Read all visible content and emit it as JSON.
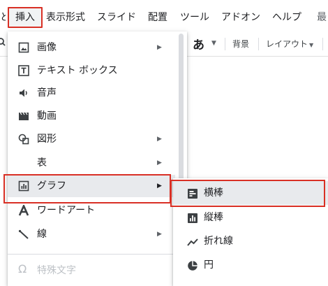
{
  "menubar": {
    "cut_left": "と",
    "items": [
      "挿入",
      "表示形式",
      "スライド",
      "配置",
      "ツール",
      "アドオン",
      "ヘルプ"
    ],
    "cut_right": "最"
  },
  "toolbar": {
    "font_glyph": "あ",
    "background_label": "背景",
    "layout_label": "レイアウト"
  },
  "insert_menu": {
    "items": [
      {
        "label": "画像",
        "icon": "image-icon",
        "has_submenu": true
      },
      {
        "label": "テキスト ボックス",
        "icon": "text-box-icon",
        "has_submenu": false
      },
      {
        "label": "音声",
        "icon": "audio-icon",
        "has_submenu": false
      },
      {
        "label": "動画",
        "icon": "video-icon",
        "has_submenu": false
      },
      {
        "label": "図形",
        "icon": "shape-icon",
        "has_submenu": true
      },
      {
        "label": "表",
        "icon": "",
        "has_submenu": true
      },
      {
        "label": "グラフ",
        "icon": "chart-icon",
        "has_submenu": true,
        "highlighted": true
      },
      {
        "label": "ワードアート",
        "icon": "word-art-icon",
        "has_submenu": false
      },
      {
        "label": "線",
        "icon": "line-icon",
        "has_submenu": true
      },
      {
        "label": "特殊文字",
        "icon": "omega-icon",
        "has_submenu": false,
        "disabled": true
      }
    ]
  },
  "chart_submenu": {
    "items": [
      {
        "label": "横棒",
        "icon": "bar-chart-icon",
        "highlighted": true
      },
      {
        "label": "縦棒",
        "icon": "column-chart-icon"
      },
      {
        "label": "折れ線",
        "icon": "line-chart-icon"
      },
      {
        "label": "円",
        "icon": "pie-chart-icon"
      }
    ]
  },
  "colors": {
    "highlight_border": "#d93025",
    "hover_bg": "#e8eaed",
    "text": "#202124"
  }
}
